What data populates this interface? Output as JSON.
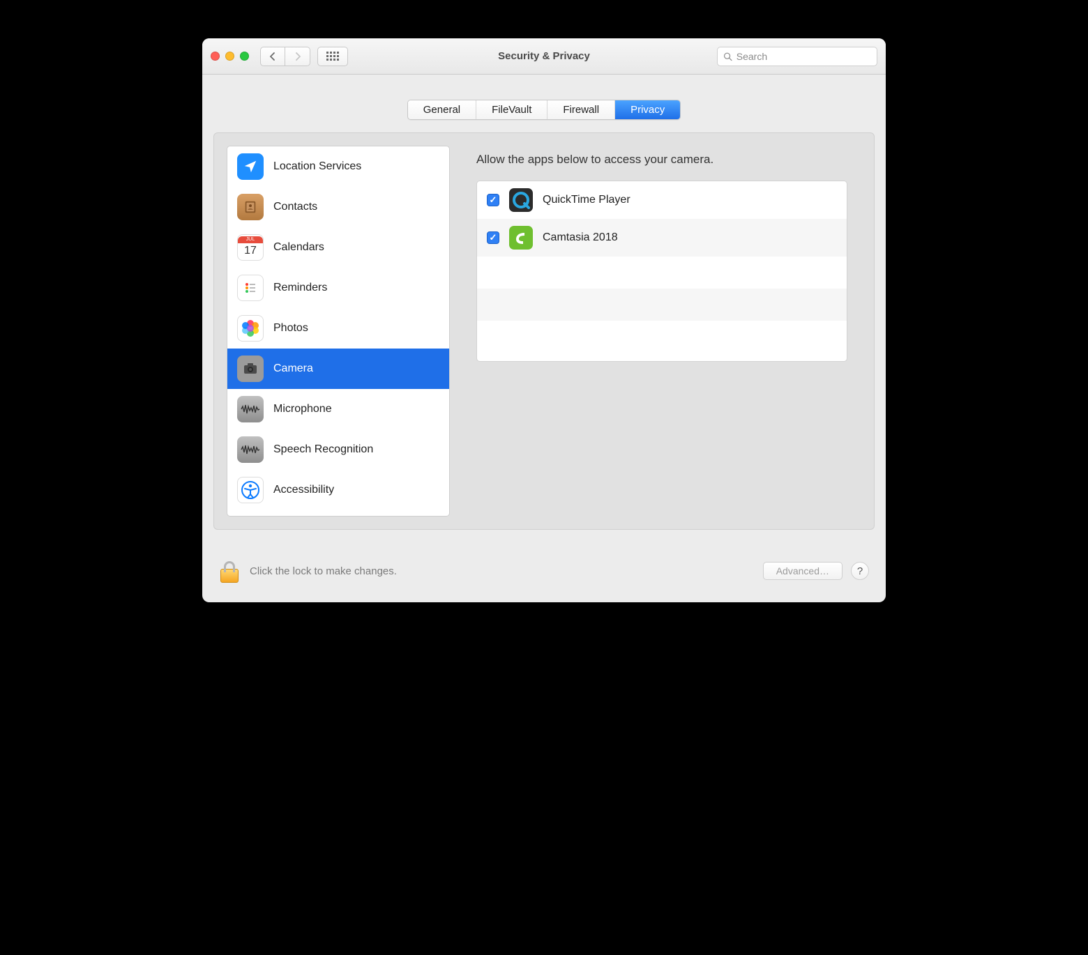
{
  "window": {
    "title": "Security & Privacy"
  },
  "search": {
    "placeholder": "Search"
  },
  "tabs": [
    {
      "label": "General"
    },
    {
      "label": "FileVault"
    },
    {
      "label": "Firewall"
    },
    {
      "label": "Privacy",
      "active": true
    }
  ],
  "sidebar": {
    "items": [
      {
        "label": "Location Services",
        "icon": "location"
      },
      {
        "label": "Contacts",
        "icon": "contacts"
      },
      {
        "label": "Calendars",
        "icon": "calendar",
        "cal_month": "JUL",
        "cal_day": "17"
      },
      {
        "label": "Reminders",
        "icon": "reminders"
      },
      {
        "label": "Photos",
        "icon": "photos"
      },
      {
        "label": "Camera",
        "icon": "camera",
        "selected": true
      },
      {
        "label": "Microphone",
        "icon": "microphone"
      },
      {
        "label": "Speech Recognition",
        "icon": "speech"
      },
      {
        "label": "Accessibility",
        "icon": "accessibility"
      }
    ]
  },
  "main": {
    "heading": "Allow the apps below to access your camera.",
    "apps": [
      {
        "name": "QuickTime Player",
        "checked": true
      },
      {
        "name": "Camtasia 2018",
        "checked": true
      }
    ]
  },
  "footer": {
    "lock_text": "Click the lock to make changes.",
    "advanced_label": "Advanced…"
  }
}
